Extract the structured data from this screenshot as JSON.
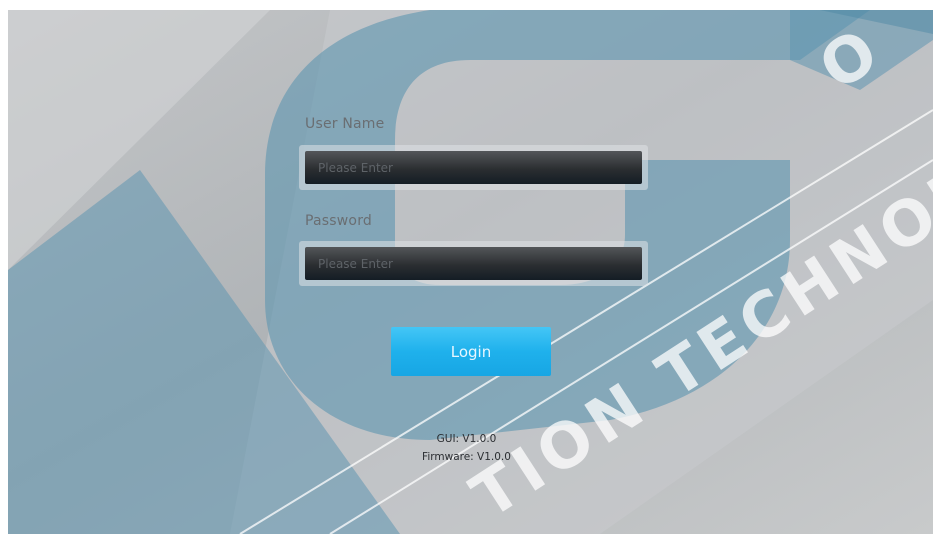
{
  "login_form": {
    "username_label": "User Name",
    "username_placeholder": "Please Enter",
    "password_label": "Password",
    "password_placeholder": "Please Enter",
    "login_label": "Login"
  },
  "footer": {
    "gui_version": "GUI: V1.0.0",
    "firmware_version": "Firmware: V1.0.0"
  },
  "watermark": {
    "text": "VG TION TECHNOL"
  },
  "colors": {
    "background_gray": "#b9bcbf",
    "logo_teal": "#5f96b0",
    "login_blue": "#1fb1ec",
    "input_dark": "#2b2e31"
  }
}
